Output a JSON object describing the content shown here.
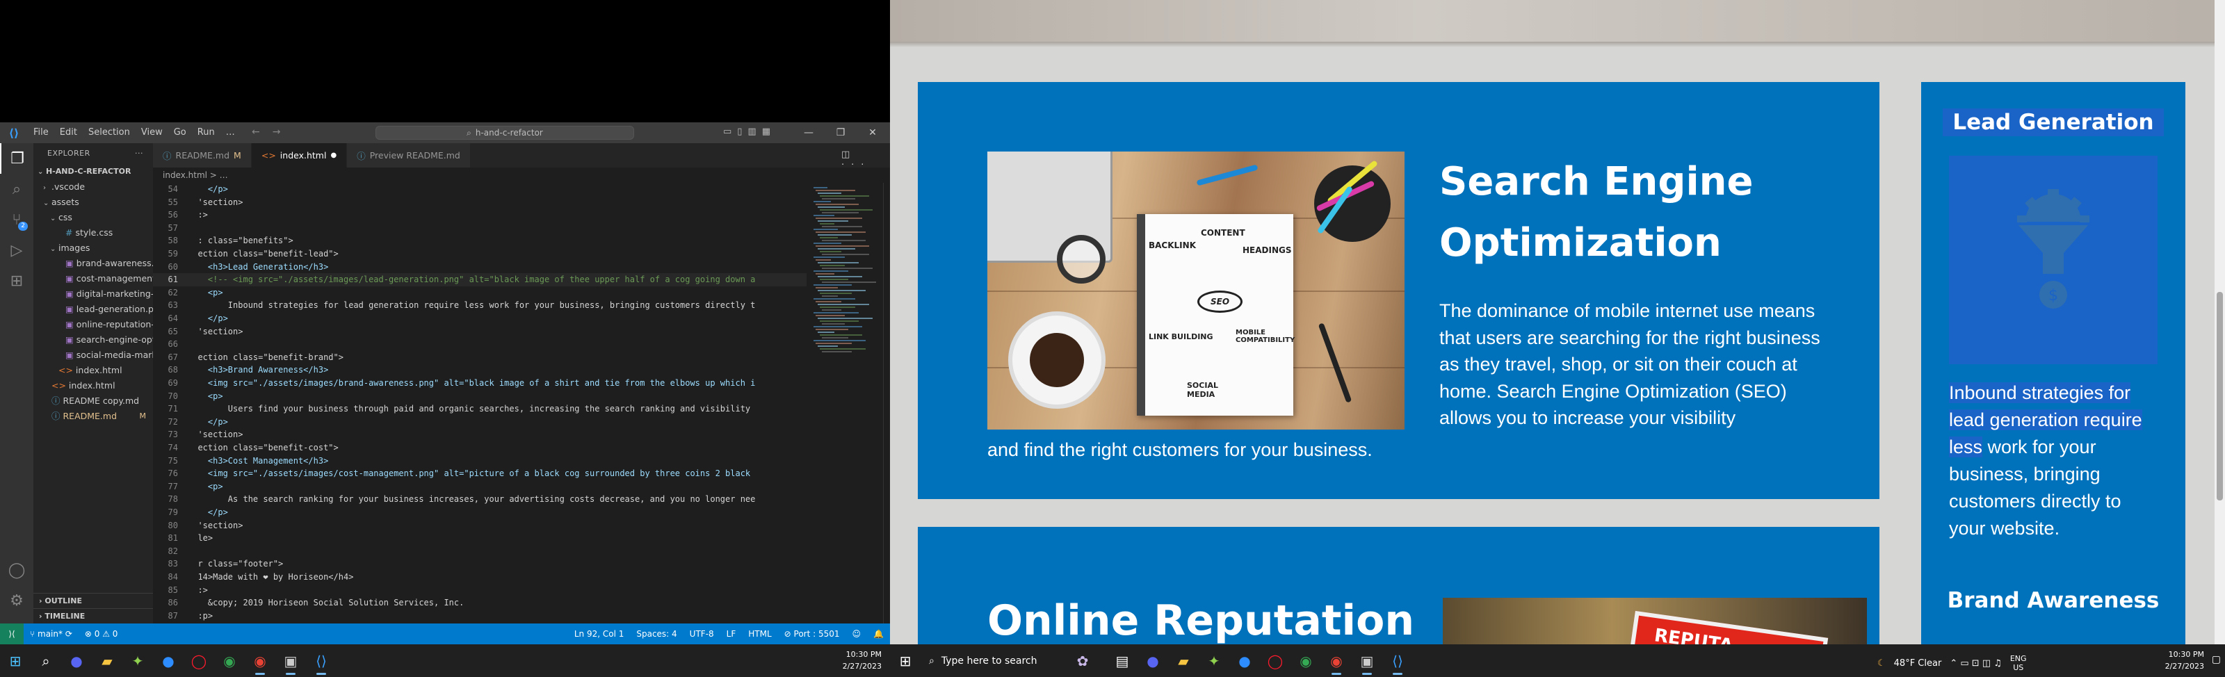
{
  "vscode": {
    "menu": [
      "File",
      "Edit",
      "Selection",
      "View",
      "Go",
      "Run",
      "…"
    ],
    "search_center": "h-and-c-refactor",
    "explorer_title": "EXPLORER",
    "project_name": "H-AND-C-REFACTOR",
    "tree": [
      {
        "label": ".vscode",
        "type": "folder",
        "indent": 1,
        "chev": "›"
      },
      {
        "label": "assets",
        "type": "folder",
        "indent": 1,
        "chev": "⌄"
      },
      {
        "label": "css",
        "type": "folder",
        "indent": 2,
        "chev": "⌄"
      },
      {
        "label": "style.css",
        "type": "css",
        "indent": 3,
        "chev": ""
      },
      {
        "label": "images",
        "type": "folder",
        "indent": 2,
        "chev": "⌄"
      },
      {
        "label": "brand-awareness.p...",
        "type": "img",
        "indent": 3,
        "chev": ""
      },
      {
        "label": "cost-management...",
        "type": "img",
        "indent": 3,
        "chev": ""
      },
      {
        "label": "digital-marketing-...",
        "type": "img",
        "indent": 3,
        "chev": ""
      },
      {
        "label": "lead-generation.png",
        "type": "img",
        "indent": 3,
        "chev": ""
      },
      {
        "label": "online-reputation-...",
        "type": "img",
        "indent": 3,
        "chev": ""
      },
      {
        "label": "search-engine-opti...",
        "type": "img",
        "indent": 3,
        "chev": ""
      },
      {
        "label": "social-media-mark...",
        "type": "img",
        "indent": 3,
        "chev": ""
      },
      {
        "label": "index.html",
        "type": "html",
        "indent": 2,
        "chev": ""
      },
      {
        "label": "index.html",
        "type": "html",
        "indent": 1,
        "chev": ""
      },
      {
        "label": "README copy.md",
        "type": "md",
        "indent": 1,
        "chev": ""
      },
      {
        "label": "README.md",
        "type": "md",
        "indent": 1,
        "chev": "",
        "mark": "M"
      }
    ],
    "outline_label": "OUTLINE",
    "timeline_label": "TIMELINE",
    "tabs": [
      {
        "label": "README.md",
        "mark": "M",
        "active": false
      },
      {
        "label": "index.html",
        "mark": "●",
        "active": true
      },
      {
        "label": "Preview README.md",
        "mark": "",
        "active": false
      }
    ],
    "breadcrumb": "index.html > …",
    "code_lines": [
      {
        "n": "54",
        "t": "    </p>"
      },
      {
        "n": "55",
        "t": "  'section>"
      },
      {
        "n": "56",
        "t": "  :>"
      },
      {
        "n": "57",
        "t": ""
      },
      {
        "n": "58",
        "t": "  : class=\"benefits\">"
      },
      {
        "n": "59",
        "t": "  ection class=\"benefit-lead\">"
      },
      {
        "n": "60",
        "t": "    <h3>Lead Generation</h3>"
      },
      {
        "n": "61",
        "t": "    <!-- <img src=\"./assets/images/lead-generation.png\" alt=\"black image of thee upper half of a cog going down a"
      },
      {
        "n": "62",
        "t": "    <p>"
      },
      {
        "n": "63",
        "t": "        Inbound strategies for lead generation require less work for your business, bringing customers directly t"
      },
      {
        "n": "64",
        "t": "    </p>"
      },
      {
        "n": "65",
        "t": "  'section>"
      },
      {
        "n": "66",
        "t": ""
      },
      {
        "n": "67",
        "t": "  ection class=\"benefit-brand\">"
      },
      {
        "n": "68",
        "t": "    <h3>Brand Awareness</h3>"
      },
      {
        "n": "69",
        "t": "    <img src=\"./assets/images/brand-awareness.png\" alt=\"black image of a shirt and tie from the elbows up which i"
      },
      {
        "n": "70",
        "t": "    <p>"
      },
      {
        "n": "71",
        "t": "        Users find your business through paid and organic searches, increasing the search ranking and visibility"
      },
      {
        "n": "72",
        "t": "    </p>"
      },
      {
        "n": "73",
        "t": "  'section>"
      },
      {
        "n": "74",
        "t": "  ection class=\"benefit-cost\">"
      },
      {
        "n": "75",
        "t": "    <h3>Cost Management</h3>"
      },
      {
        "n": "76",
        "t": "    <img src=\"./assets/images/cost-management.png\" alt=\"picture of a black cog surrounded by three coins 2 black"
      },
      {
        "n": "77",
        "t": "    <p>"
      },
      {
        "n": "78",
        "t": "        As the search ranking for your business increases, your advertising costs decrease, and you no longer nee"
      },
      {
        "n": "79",
        "t": "    </p>"
      },
      {
        "n": "80",
        "t": "  'section>"
      },
      {
        "n": "81",
        "t": "  le>"
      },
      {
        "n": "82",
        "t": ""
      },
      {
        "n": "83",
        "t": "  r class=\"footer\">"
      },
      {
        "n": "84",
        "t": "  14>Made with ❤ by Horiseon</h4>"
      },
      {
        "n": "85",
        "t": "  :>"
      },
      {
        "n": "86",
        "t": "    &copy; 2019 Horiseon Social Solution Services, Inc."
      },
      {
        "n": "87",
        "t": "  :p>"
      }
    ],
    "status": {
      "branch": "main*",
      "problems": "⊗ 0 ⚠ 0",
      "position": "Ln 92, Col 1",
      "spaces": "Spaces: 4",
      "encoding": "UTF-8",
      "eol": "LF",
      "language": "HTML",
      "port": "Port : 5501"
    }
  },
  "taskbar_left": {
    "time": "10:30 PM",
    "date": "2/27/2023"
  },
  "taskbar_right": {
    "search_placeholder": "Type here to search",
    "weather": "48°F  Clear",
    "lang": "ENG",
    "region": "US",
    "time": "10:30 PM",
    "date": "2/27/2023"
  },
  "site": {
    "seo_title": "Search Engine Optimization",
    "seo_text": "The dominance of mobile internet use means that users are searching for the right business as they travel, shop, or sit on their couch at home. Search Engine Optimization (SEO) allows you to increase your visibility",
    "seo_text_tail": "and find the right customers for your business.",
    "seo_img_words": {
      "content": "CONTENT",
      "backlink": "BACKLINK",
      "headings": "HEADINGS",
      "seo": "SEO",
      "link_building": "LINK BUILDING",
      "mobile": "MOBILE COMPATIBILITY",
      "social": "SOCIAL MEDIA"
    },
    "rep_title": "Online Reputation",
    "rep_sign": "REPUTA",
    "lead_title": "Lead Generation",
    "lead_text_hl": "Inbound strategies for lead generation require less",
    "lead_text_rest": " work for your business, bringing customers directly to your website.",
    "brand_title": "Brand Awareness"
  },
  "colors": {
    "card": "#0072bb",
    "highlight": "#1a63c7",
    "statusbar": "#007acc"
  }
}
